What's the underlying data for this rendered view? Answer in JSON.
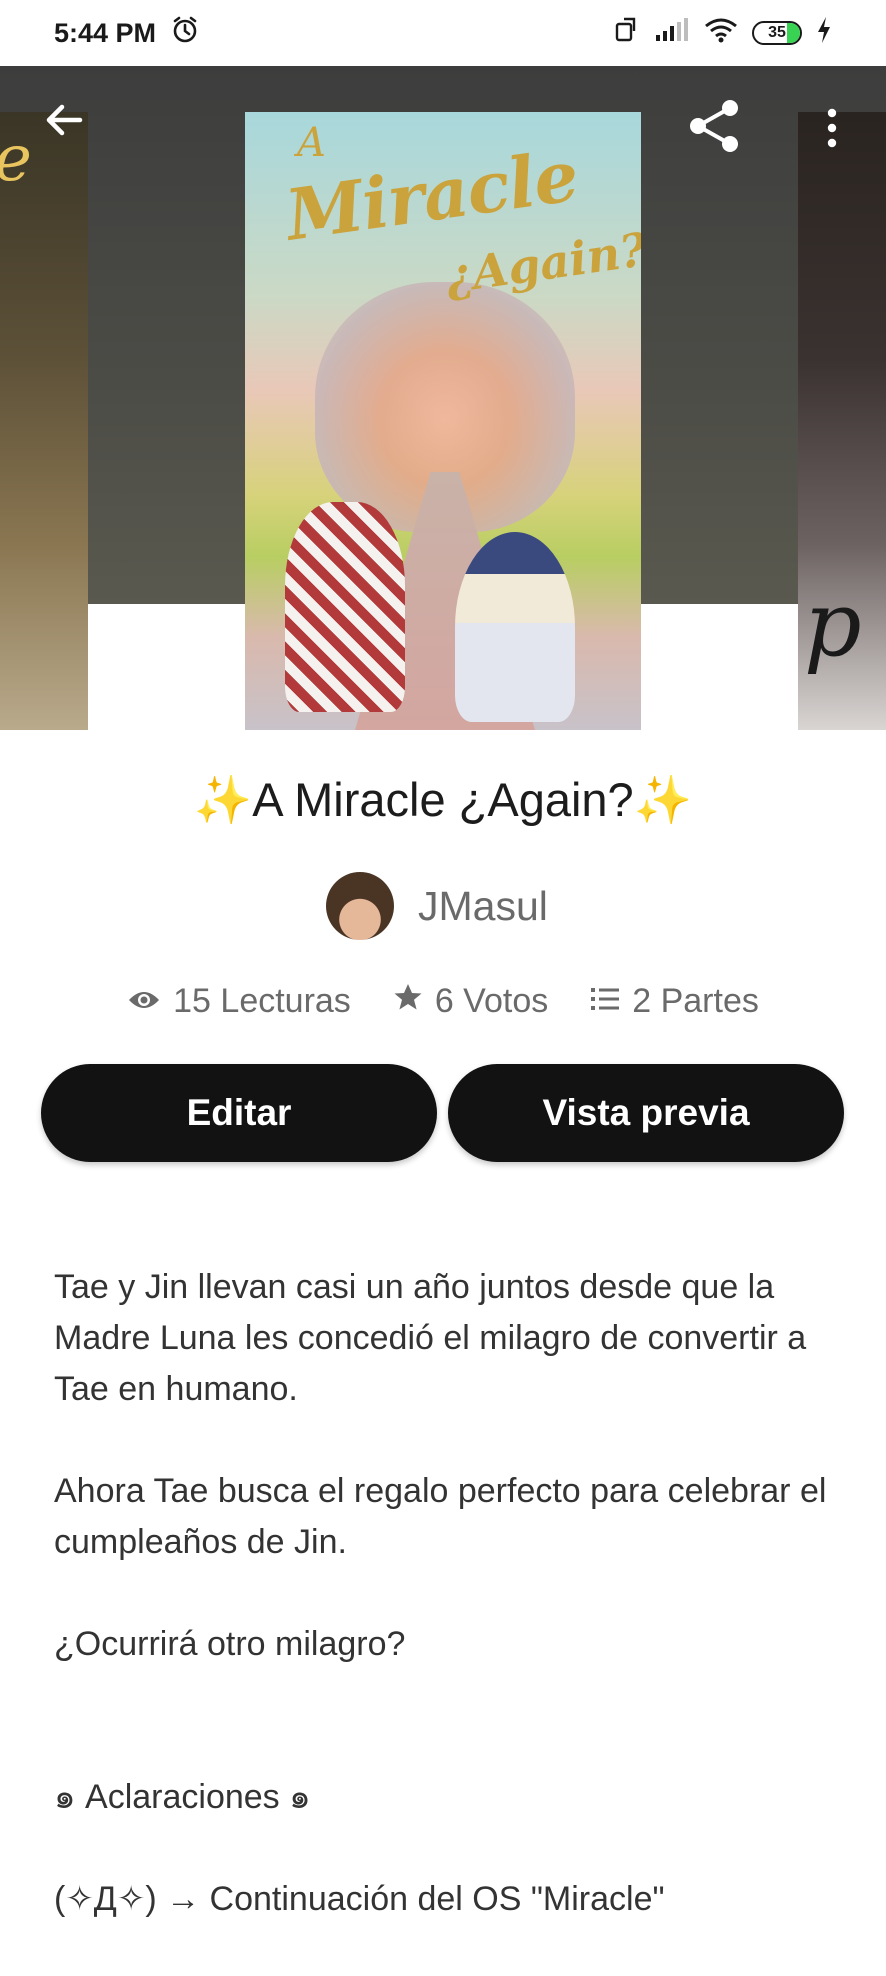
{
  "status_bar": {
    "time": "5:44 PM",
    "battery": "35"
  },
  "header": {
    "back_icon": "arrow-left-icon",
    "share_icon": "share-icon",
    "more_icon": "more-vertical-icon"
  },
  "cover": {
    "title_a": "A",
    "title_main": "Miracle",
    "title_sub": "¿Again?",
    "side_left_glyph": "e",
    "side_right_glyph": "p"
  },
  "story": {
    "title": "✨A Miracle ¿Again?✨",
    "author": "JMasul"
  },
  "stats": {
    "reads": "15 Lecturas",
    "votes": "6 Votos",
    "parts": "2 Partes"
  },
  "actions": {
    "edit": "Editar",
    "preview": "Vista previa"
  },
  "description": {
    "paragraph1": "Tae y Jin llevan casi un año juntos desde que la Madre Luna les concedió el milagro de convertir a Tae en humano.",
    "paragraph2": "Ahora Tae busca el regalo perfecto para celebrar el cumpleaños de Jin.",
    "paragraph3": "¿Ocurrirá otro milagro?",
    "section": "๑ Aclaraciones ๑",
    "note": "(✧Д✧) → Continuación del OS \"Miracle\""
  },
  "colors": {
    "button_bg": "#121212",
    "stat_text": "#6a6a6a",
    "battery_fill": "#39d353"
  }
}
